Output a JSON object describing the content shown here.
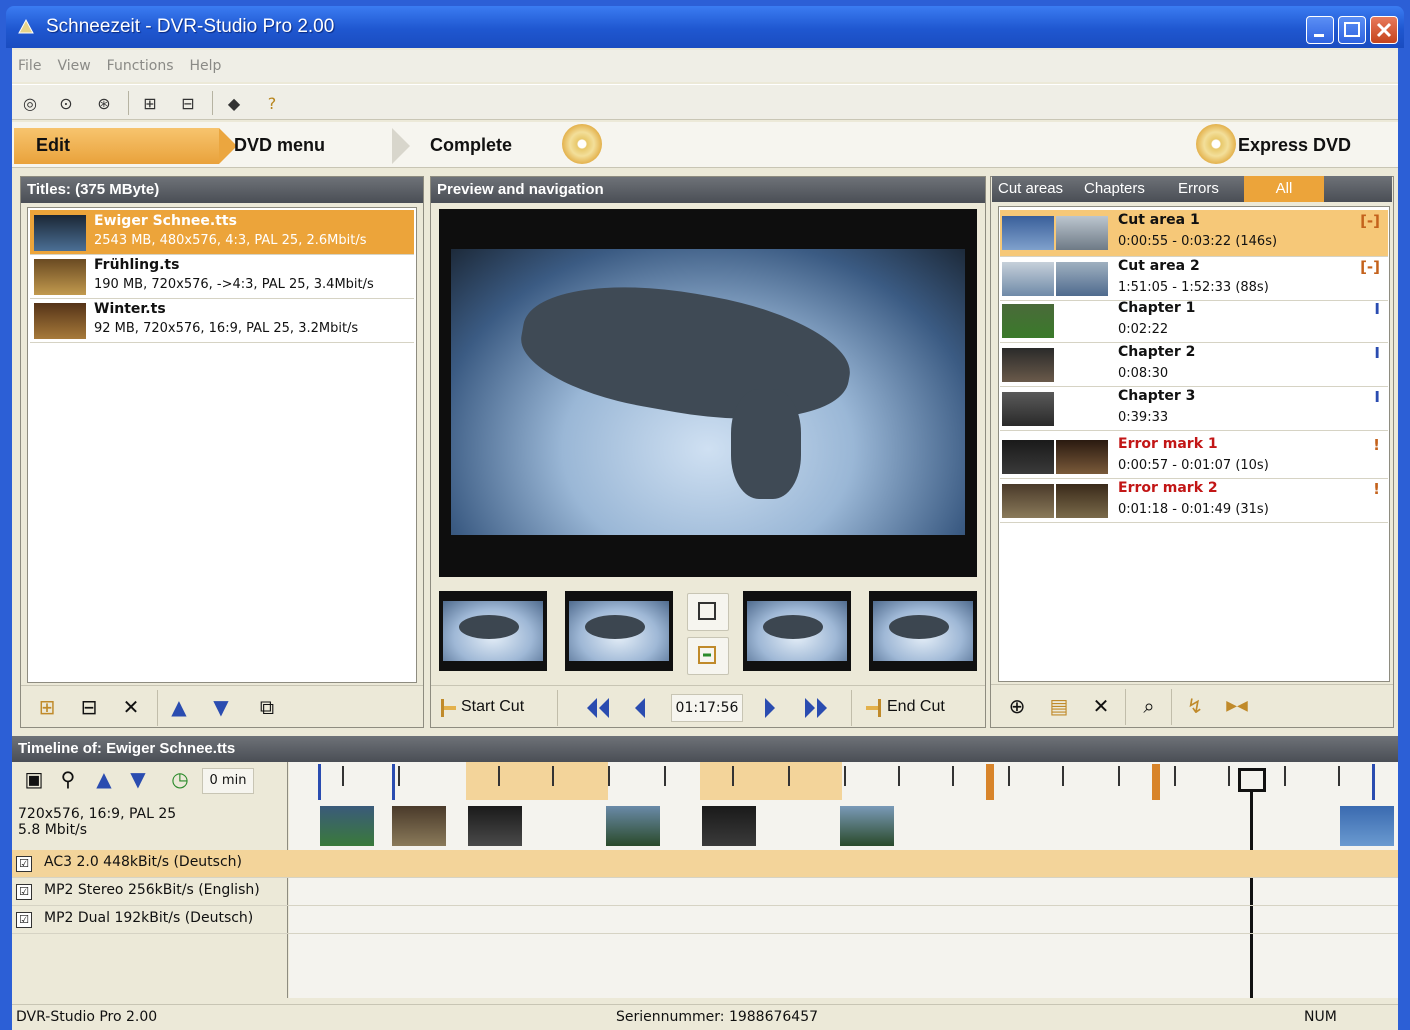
{
  "window": {
    "title": "Schneezeit - DVR-Studio Pro 2.00"
  },
  "menu": [
    "File",
    "View",
    "Functions",
    "Help"
  ],
  "workflow": {
    "edit": "Edit",
    "dvd_menu": "DVD menu",
    "complete": "Complete",
    "express": "Express DVD"
  },
  "titles_panel": {
    "header": "Titles: (375 MByte)",
    "items": [
      {
        "name": "Ewiger Schnee.tts",
        "info": "2543 MB, 480x576, 4:3, PAL 25, 2.6Mbit/s"
      },
      {
        "name": "Frühling.ts",
        "info": "190 MB, 720x576, ->4:3, PAL 25, 3.4Mbit/s"
      },
      {
        "name": "Winter.ts",
        "info": "92 MB, 720x576, 16:9, PAL 25, 3.2Mbit/s"
      }
    ]
  },
  "preview": {
    "header": "Preview and navigation",
    "start_cut": "Start Cut",
    "end_cut": "End Cut",
    "timecode": "01:17:56"
  },
  "marks_panel": {
    "tabs": [
      "Cut areas",
      "Chapters",
      "Errors",
      "All"
    ],
    "items": [
      {
        "name": "Cut area 1",
        "time": "0:00:55 - 0:03:22 (146s)",
        "symbol": "[-]"
      },
      {
        "name": "Cut area 2",
        "time": "1:51:05 - 1:52:33 (88s)",
        "symbol": "[-]"
      },
      {
        "name": "Chapter 1",
        "time": "0:02:22",
        "symbol": "I"
      },
      {
        "name": "Chapter 2",
        "time": "0:08:30",
        "symbol": "I"
      },
      {
        "name": "Chapter 3",
        "time": "0:39:33",
        "symbol": "I"
      },
      {
        "name": "Error mark 1",
        "time": "0:00:57 - 0:01:07 (10s)",
        "symbol": "!"
      },
      {
        "name": "Error mark 2",
        "time": "0:01:18 - 0:01:49 (31s)",
        "symbol": "!"
      }
    ]
  },
  "timeline": {
    "header": "Timeline of: Ewiger Schnee.tts",
    "zoom": "0 min",
    "video_info_line1": "720x576, 16:9, PAL 25",
    "video_info_line2": "5.8 Mbit/s",
    "audio": [
      {
        "label": "AC3 2.0 448kBit/s (Deutsch)",
        "checked": true
      },
      {
        "label": "MP2 Stereo 256kBit/s (English)",
        "checked": true
      },
      {
        "label": "MP2 Dual 192kBit/s (Deutsch)",
        "checked": true
      }
    ]
  },
  "statusbar": {
    "app": "DVR-Studio Pro 2.00",
    "serial": "Seriennummer: 1988676457",
    "num": "NUM"
  },
  "icons": {
    "check": "☑",
    "arrow_up": "▲",
    "arrow_down": "▼",
    "delete": "✕"
  },
  "colors": {
    "accent": "#eca43a",
    "titlebar": "#1f57d0",
    "error": "#c21616"
  }
}
